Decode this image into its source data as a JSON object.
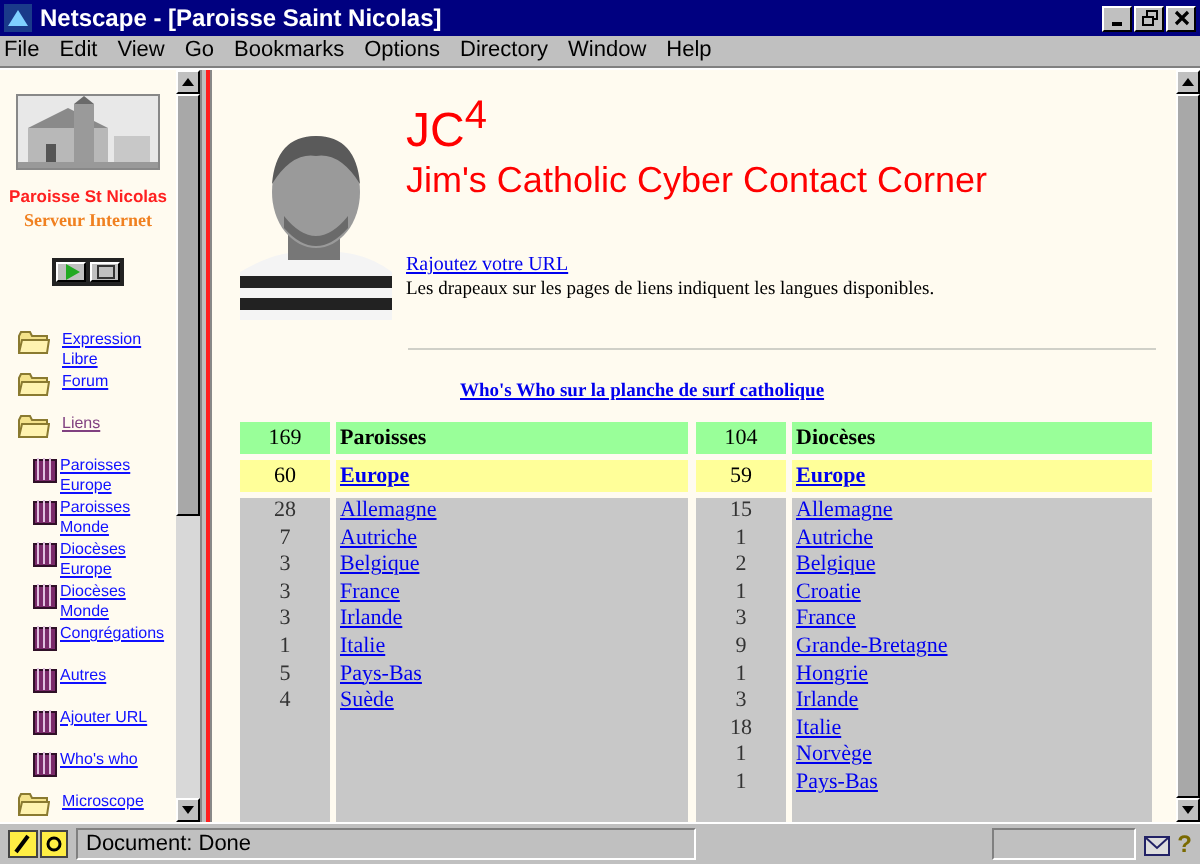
{
  "window": {
    "title": "Netscape - [Paroisse Saint Nicolas]"
  },
  "menu": [
    "File",
    "Edit",
    "View",
    "Go",
    "Bookmarks",
    "Options",
    "Directory",
    "Window",
    "Help"
  ],
  "sidebar": {
    "caption": "Paroisse St Nicolas",
    "subtitle": "Serveur Internet",
    "items": [
      {
        "label": "Expression Libre",
        "kind": "folder",
        "visited": false
      },
      {
        "label": "Forum",
        "kind": "folder",
        "visited": false
      },
      {
        "label": "Liens",
        "kind": "folder",
        "visited": true,
        "children": [
          {
            "label": "Paroisses Europe",
            "kind": "book",
            "visited": false
          },
          {
            "label": "Paroisses Monde",
            "kind": "book",
            "visited": false
          },
          {
            "label": "Diocèses Europe",
            "kind": "book",
            "visited": false
          },
          {
            "label": "Diocèses Monde",
            "kind": "book",
            "visited": false
          },
          {
            "label": "Congrégations",
            "kind": "book",
            "visited": false
          },
          {
            "label": "Autres",
            "kind": "book",
            "visited": false
          },
          {
            "label": "Ajouter URL",
            "kind": "book",
            "visited": false
          },
          {
            "label": "Who's who",
            "kind": "book",
            "visited": false
          }
        ]
      },
      {
        "label": "Microscope",
        "kind": "folder",
        "visited": false
      }
    ]
  },
  "page": {
    "heading": "JC$^{4}$",
    "title": "Jim's Catholic Cyber Contact Corner",
    "add_link": "Rajoutez votre URL",
    "note": "Les drapeaux sur les pages de liens indiquent les langues disponibles.",
    "whos_who_link": "Who's Who sur la planche de surf catholique",
    "tables": [
      {
        "count": "169",
        "title": "Paroisses",
        "region": {
          "count": "60",
          "label": "Europe"
        },
        "rows": [
          {
            "count": "28",
            "label": "Allemagne"
          },
          {
            "count": "7",
            "label": "Autriche"
          },
          {
            "count": "3",
            "label": "Belgique"
          },
          {
            "count": "3",
            "label": "France"
          },
          {
            "count": "3",
            "label": "Irlande"
          },
          {
            "count": "1",
            "label": "Italie"
          },
          {
            "count": "5",
            "label": "Pays-Bas"
          },
          {
            "count": "4",
            "label": "Suède"
          }
        ]
      },
      {
        "count": "104",
        "title": "Diocèses",
        "region": {
          "count": "59",
          "label": "Europe"
        },
        "rows": [
          {
            "count": "15",
            "label": "Allemagne"
          },
          {
            "count": "1",
            "label": "Autriche"
          },
          {
            "count": "2",
            "label": "Belgique"
          },
          {
            "count": "1",
            "label": "Croatie"
          },
          {
            "count": "3",
            "label": "France"
          },
          {
            "count": "9",
            "label": "Grande-Bretagne"
          },
          {
            "count": "1",
            "label": "Hongrie"
          },
          {
            "count": "3",
            "label": "Irlande"
          },
          {
            "count": "18",
            "label": "Italie"
          },
          {
            "count": "1",
            "label": "Norvège"
          },
          {
            "count": "1",
            "label": "Pays-Bas"
          }
        ]
      }
    ]
  },
  "status_bar": {
    "text": "Document: Done",
    "help_glyph": "?"
  }
}
